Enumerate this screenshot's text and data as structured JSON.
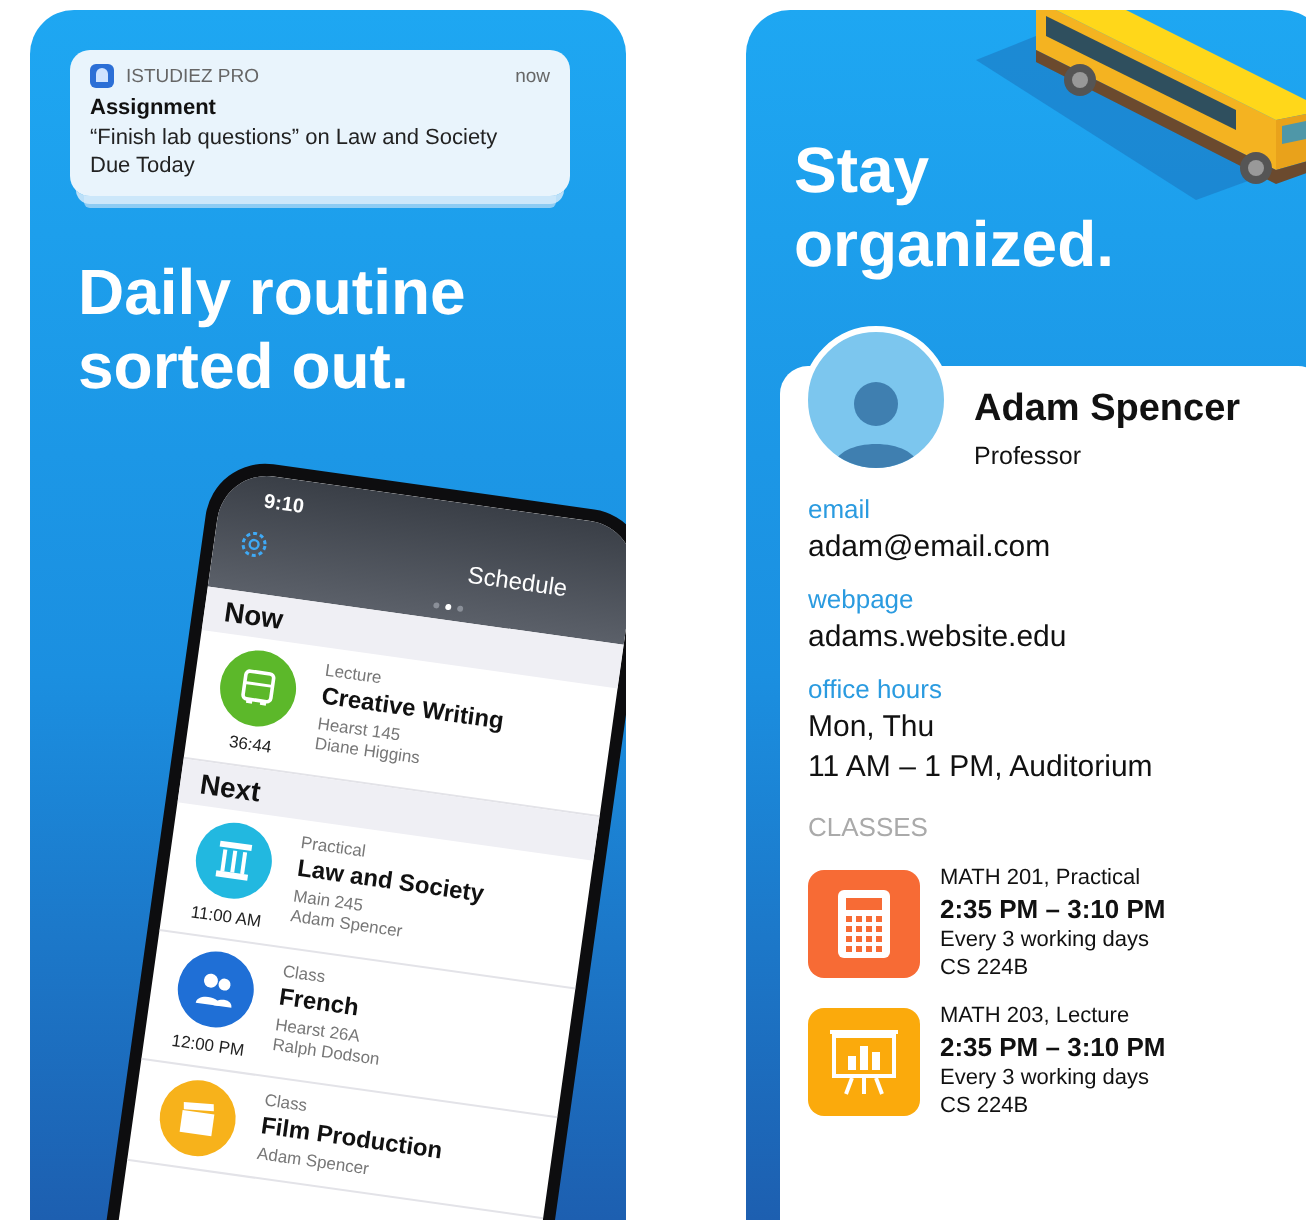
{
  "left": {
    "notification": {
      "app": "ISTUDIEZ PRO",
      "time": "now",
      "title": "Assignment",
      "body": "“Finish lab questions” on Law and Society",
      "due": "Due Today"
    },
    "headline": "Daily routine sorted out.",
    "phone": {
      "status_time": "9:10",
      "title": "Schedule",
      "page_dots": [
        {
          "selected": false
        },
        {
          "selected": true
        },
        {
          "selected": false
        }
      ],
      "sections": [
        {
          "heading": "Now",
          "items": [
            {
              "type": "Lecture",
              "name": "Creative Writing",
              "room": "Hearst 145",
              "teacher": "Diane Higgins",
              "time": "36:44",
              "color": "#5cb82a"
            }
          ]
        },
        {
          "heading": "Next",
          "items": [
            {
              "type": "Practical",
              "name": "Law and Society",
              "room": "Main 245",
              "teacher": "Adam Spencer",
              "time": "11:00 AM",
              "color": "#22b8e0"
            },
            {
              "type": "Class",
              "name": "French",
              "room": "Hearst 26A",
              "teacher": "Ralph Dodson",
              "time": "12:00 PM",
              "color": "#1f6fd6"
            },
            {
              "type": "Class",
              "name": "Film Production",
              "teacher": "Adam Spencer",
              "color": "#f7b21b"
            }
          ]
        }
      ]
    }
  },
  "right": {
    "headline": "Stay organized.",
    "contact": {
      "name": "Adam Spencer",
      "role": "Professor",
      "fields": [
        {
          "label": "email",
          "lines": [
            "adam@email.com"
          ]
        },
        {
          "label": "webpage",
          "lines": [
            "adams.website.edu"
          ]
        },
        {
          "label": "office hours",
          "lines": [
            "Mon, Thu",
            "11 AM – 1 PM, Auditorium"
          ]
        }
      ],
      "classes_heading": "CLASSES",
      "classes": [
        {
          "title": "MATH 201, Practical",
          "time": "2:35 PM – 3:10 PM",
          "repeat": "Every 3 working days",
          "room": "CS 224B",
          "color": "#f76b35"
        },
        {
          "title": "MATH 203, Lecture",
          "time": "2:35 PM – 3:10 PM",
          "repeat": "Every 3 working days",
          "room": "CS 224B",
          "color": "#fbaa0c"
        }
      ]
    }
  }
}
